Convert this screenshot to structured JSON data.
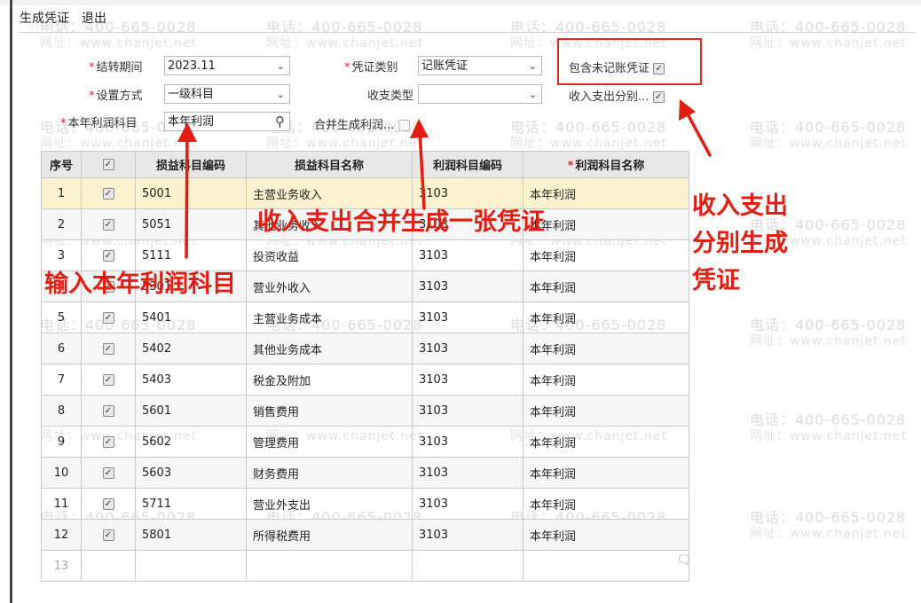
{
  "menu": {
    "generate": "生成凭证",
    "exit": "退出"
  },
  "watermark": {
    "phone": "电话：400-665-0028",
    "url": "网址：www.chanjet.net"
  },
  "form": {
    "period_label": "结转期间",
    "period_value": "2023.11",
    "voucher_type_label": "凭证类别",
    "voucher_type_value": "记账凭证",
    "include_unposted_label": "包含未记账凭证",
    "setup_label": "设置方式",
    "setup_value": "一级科目",
    "inout_type_label": "收支类型",
    "inout_type_value": "",
    "separate_label": "收入支出分别...",
    "profit_subject_label": "本年利润科目",
    "profit_subject_value": "本年利润",
    "merge_label": "合并生成利润..."
  },
  "table": {
    "headers": [
      "序号",
      "",
      "损益科目编码",
      "损益科目名称",
      "利润科目编码",
      "利润科目名称"
    ],
    "rows": [
      {
        "no": "1",
        "code": "5001",
        "name": "主营业务收入",
        "pcode": "3103",
        "pname": "本年利润"
      },
      {
        "no": "2",
        "code": "5051",
        "name": "其他业务收入",
        "pcode": "3103",
        "pname": "本年利润"
      },
      {
        "no": "3",
        "code": "5111",
        "name": "投资收益",
        "pcode": "3103",
        "pname": "本年利润"
      },
      {
        "no": "4",
        "code": "5301",
        "name": "营业外收入",
        "pcode": "3103",
        "pname": "本年利润"
      },
      {
        "no": "5",
        "code": "5401",
        "name": "主营业务成本",
        "pcode": "3103",
        "pname": "本年利润"
      },
      {
        "no": "6",
        "code": "5402",
        "name": "其他业务成本",
        "pcode": "3103",
        "pname": "本年利润"
      },
      {
        "no": "7",
        "code": "5403",
        "name": "税金及附加",
        "pcode": "3103",
        "pname": "本年利润"
      },
      {
        "no": "8",
        "code": "5601",
        "name": "销售费用",
        "pcode": "3103",
        "pname": "本年利润"
      },
      {
        "no": "9",
        "code": "5602",
        "name": "管理费用",
        "pcode": "3103",
        "pname": "本年利润"
      },
      {
        "no": "10",
        "code": "5603",
        "name": "财务费用",
        "pcode": "3103",
        "pname": "本年利润"
      },
      {
        "no": "11",
        "code": "5711",
        "name": "营业外支出",
        "pcode": "3103",
        "pname": "本年利润"
      },
      {
        "no": "12",
        "code": "5801",
        "name": "所得税费用",
        "pcode": "3103",
        "pname": "本年利润"
      },
      {
        "no": "13",
        "code": "",
        "name": "",
        "pcode": "",
        "pname": ""
      }
    ]
  },
  "annotations": {
    "merge_note": "收入支出合并生成一张凭证",
    "input_note": "输入本年利润科目",
    "separate_note_1": "收入支出",
    "separate_note_2": "分别生成",
    "separate_note_3": "凭证"
  },
  "colors": {
    "annotation_red": "#e21d12",
    "highlight_row": "#fdf2cf",
    "header_bg": "#e8e8e8"
  }
}
